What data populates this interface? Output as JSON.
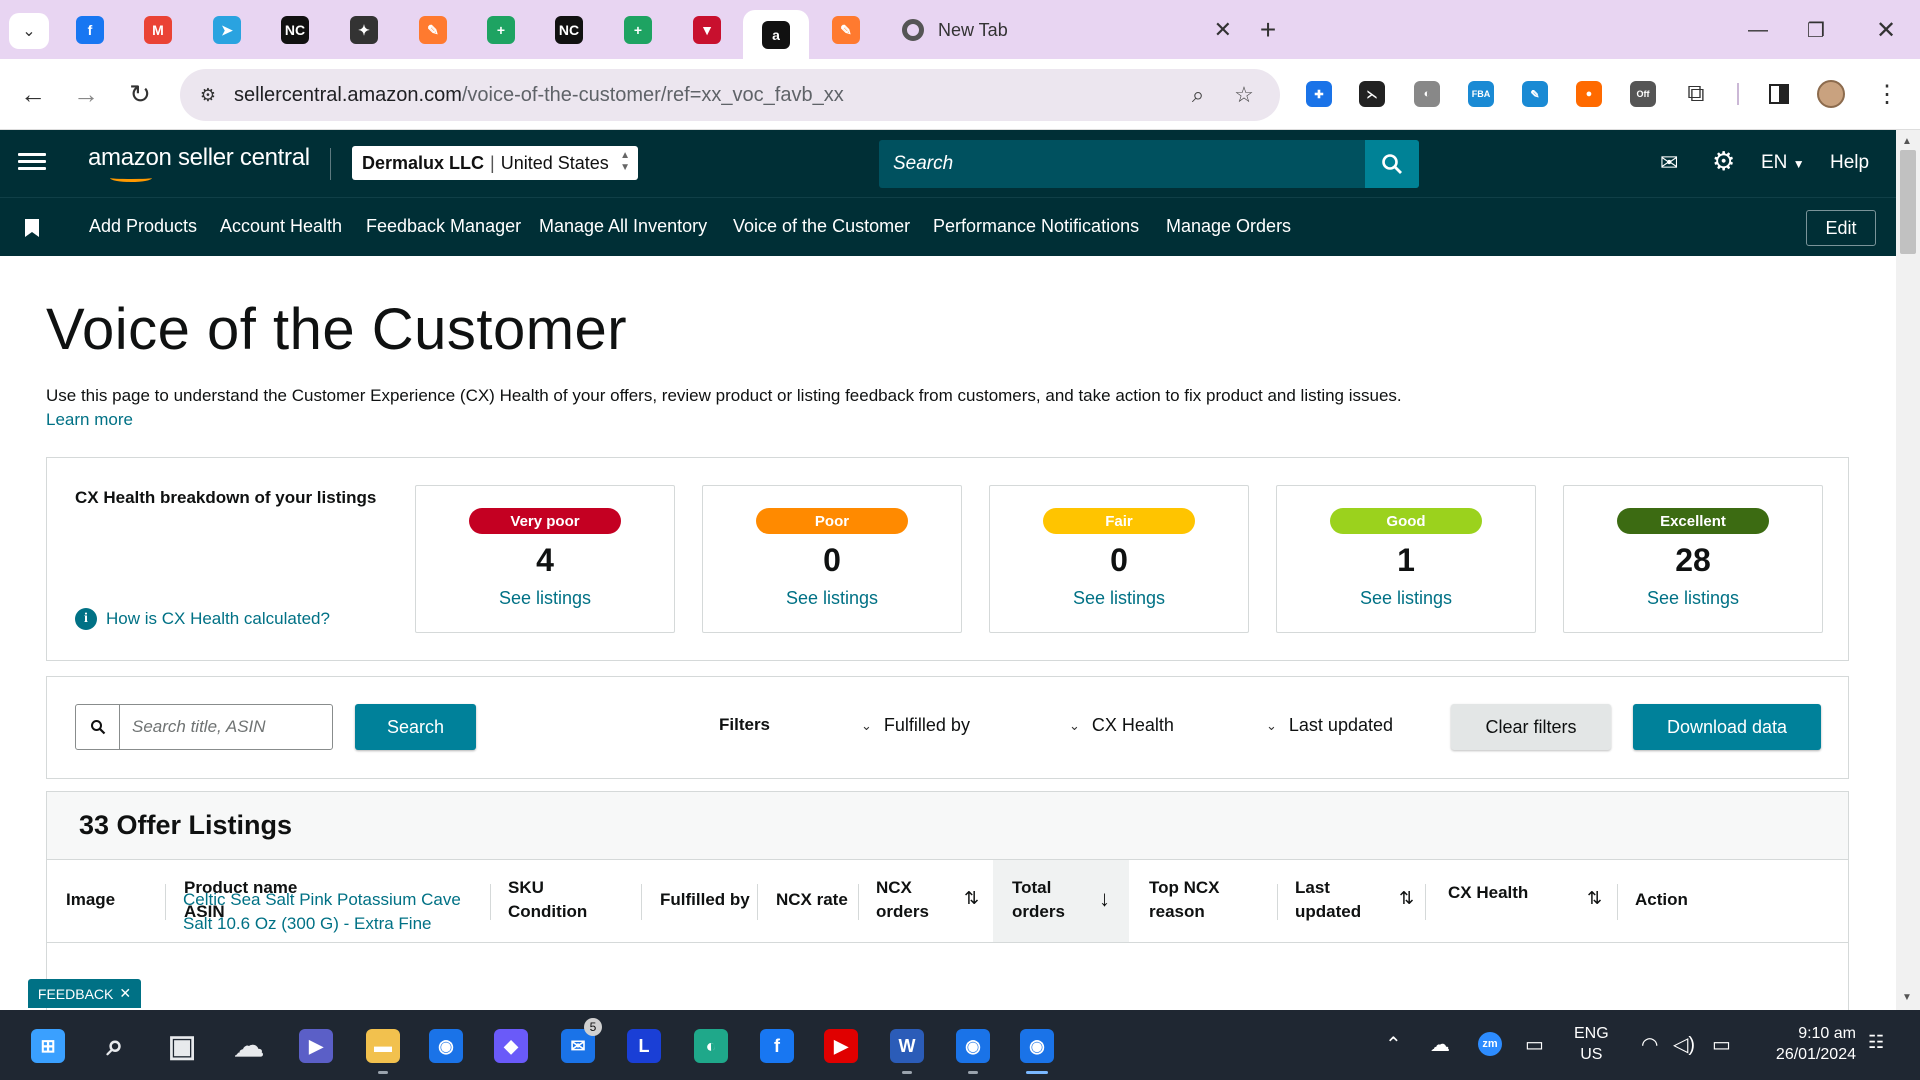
{
  "browser": {
    "tabs": [
      {
        "name": "facebook",
        "icon": "facebook-icon",
        "glyph": "f",
        "color": "#1877f2"
      },
      {
        "name": "gmail",
        "icon": "gmail-icon",
        "glyph": "M",
        "color": "#ea4335"
      },
      {
        "name": "telegram",
        "icon": "telegram-icon",
        "glyph": "➤",
        "color": "#2aa3e0"
      },
      {
        "name": "nc1",
        "icon": "nc-icon",
        "glyph": "NC",
        "color": "#111111"
      },
      {
        "name": "bird",
        "icon": "bird-icon",
        "glyph": "✦",
        "color": "#333333"
      },
      {
        "name": "pen1",
        "icon": "pen-icon",
        "glyph": "✎",
        "color": "#ff7a2f"
      },
      {
        "name": "sheets1",
        "icon": "plus-sheet-icon",
        "glyph": "+",
        "color": "#1ea362"
      },
      {
        "name": "nc2",
        "icon": "nc-icon",
        "glyph": "NC",
        "color": "#111111"
      },
      {
        "name": "sheets2",
        "icon": "plus-sheet-icon",
        "glyph": "+",
        "color": "#1ea362"
      },
      {
        "name": "vee",
        "icon": "vee-icon",
        "glyph": "▼",
        "color": "#c8102e"
      },
      {
        "name": "amazon",
        "icon": "amazon-icon",
        "glyph": "a",
        "color": "#111111",
        "active": true
      },
      {
        "name": "pen2",
        "icon": "pen-icon",
        "glyph": "✎",
        "color": "#ff7a2f"
      }
    ],
    "newtab_title": "New Tab",
    "url_host": "sellercentral.amazon.com",
    "url_path": "/voice-of-the-customer/ref=xx_voc_favb_xx",
    "extensions": [
      {
        "icon": "extension-cross-icon",
        "glyph": "✚",
        "color": "#1a73e8"
      },
      {
        "icon": "extension-sigma-icon",
        "glyph": "⋋",
        "color": "#222222"
      },
      {
        "icon": "extension-chart-icon",
        "glyph": "◐",
        "color": "#888888"
      },
      {
        "icon": "extension-fba-icon",
        "glyph": "FBA",
        "color": "#1a8ad4"
      },
      {
        "icon": "extension-pen-icon",
        "glyph": "✎",
        "color": "#1a8ad4"
      },
      {
        "icon": "extension-orange-icon",
        "glyph": "●",
        "color": "#ff6a00"
      },
      {
        "icon": "extension-off-icon",
        "glyph": "Off",
        "color": "#555555"
      }
    ]
  },
  "header": {
    "logo_text": "amazon seller central",
    "account_name": "Dermalux LLC",
    "account_region": "United States",
    "search_placeholder": "Search",
    "language": "EN",
    "help_label": "Help"
  },
  "bookmarks": {
    "items": [
      "Add Products",
      "Account Health",
      "Feedback Manager",
      "Manage All Inventory",
      "Voice of the Customer",
      "Performance Notifications",
      "Manage Orders"
    ],
    "edit_label": "Edit"
  },
  "page": {
    "title": "Voice of the Customer",
    "description": "Use this page to understand the Customer Experience (CX) Health of your offers, review product or listing feedback from customers, and take action to fix product and listing issues.",
    "learn_more": "Learn more"
  },
  "cx_health": {
    "label": "CX Health breakdown of your listings",
    "how_link": "How is CX Health calculated?",
    "cards": [
      {
        "rating": "Very poor",
        "count": "4",
        "link": "See listings",
        "color": "#c40022"
      },
      {
        "rating": "Poor",
        "count": "0",
        "link": "See listings",
        "color": "#ff8a00"
      },
      {
        "rating": "Fair",
        "count": "0",
        "link": "See listings",
        "color": "#ffc400"
      },
      {
        "rating": "Good",
        "count": "1",
        "link": "See listings",
        "color": "#9bd21d"
      },
      {
        "rating": "Excellent",
        "count": "28",
        "link": "See listings",
        "color": "#3c6b12"
      }
    ]
  },
  "filters": {
    "search_placeholder": "Search title, ASIN",
    "search_button": "Search",
    "filters_label": "Filters",
    "fulfilled_by": "Fulfilled by",
    "cx_health": "CX Health",
    "last_updated": "Last updated",
    "clear_filters": "Clear filters",
    "download_data": "Download data"
  },
  "listings": {
    "title": "33 Offer Listings",
    "columns": {
      "image": "Image",
      "product_name": "Product name",
      "asin": "ASIN",
      "sku": "SKU",
      "condition": "Condition",
      "fulfilled_by": "Fulfilled by",
      "ncx_rate": "NCX rate",
      "ncx_orders_1": "NCX",
      "ncx_orders_2": "orders",
      "total_orders_1": "Total",
      "total_orders_2": "orders",
      "top_ncx_1": "Top NCX",
      "top_ncx_2": "reason",
      "last_updated_1": "Last",
      "last_updated_2": "updated",
      "cx_health": "CX Health",
      "action": "Action"
    },
    "first_row_product": "Celtic Sea Salt Pink Potassium Cave Salt 10.6 Oz (300 G) - Extra Fine"
  },
  "feedback_tab": "FEEDBACK",
  "taskbar": {
    "apps": [
      {
        "icon": "windows-start-icon",
        "glyph": "⊞",
        "color": "#3aa0ff"
      },
      {
        "icon": "search-icon",
        "glyph": "⌕",
        "color": "transparent"
      },
      {
        "icon": "task-view-icon",
        "glyph": "▣",
        "color": "transparent"
      },
      {
        "icon": "cloud-app-icon",
        "glyph": "☁",
        "color": "transparent"
      },
      {
        "icon": "teams-icon",
        "glyph": "▶",
        "color": "#5b5fc7"
      },
      {
        "icon": "file-explorer-icon",
        "glyph": "▬",
        "color": "#f2c14e"
      },
      {
        "icon": "chrome-icon",
        "glyph": "◉",
        "color": "#1a73e8"
      },
      {
        "icon": "copilot-icon",
        "glyph": "◆",
        "color": "#6a5af9"
      },
      {
        "icon": "mail-icon",
        "glyph": "✉",
        "color": "#1a73e8"
      },
      {
        "icon": "l-app-icon",
        "glyph": "L",
        "color": "#1a3fd6"
      },
      {
        "icon": "edge-icon",
        "glyph": "◐",
        "color": "#1fa88a"
      },
      {
        "icon": "facebook-app-icon",
        "glyph": "f",
        "color": "#1877f2"
      },
      {
        "icon": "youtube-icon",
        "glyph": "▶",
        "color": "#e00000"
      },
      {
        "icon": "word-icon",
        "glyph": "W",
        "color": "#2b5cb8"
      },
      {
        "icon": "chrome-profile-icon",
        "glyph": "◉",
        "color": "#1a73e8"
      },
      {
        "icon": "chrome-profile-active-icon",
        "glyph": "◉",
        "color": "#1a73e8"
      }
    ],
    "mail_badge": "5",
    "lang_line1": "ENG",
    "lang_line2": "US",
    "time": "9:10 am",
    "date": "26/01/2024",
    "notif_badge": "22"
  }
}
